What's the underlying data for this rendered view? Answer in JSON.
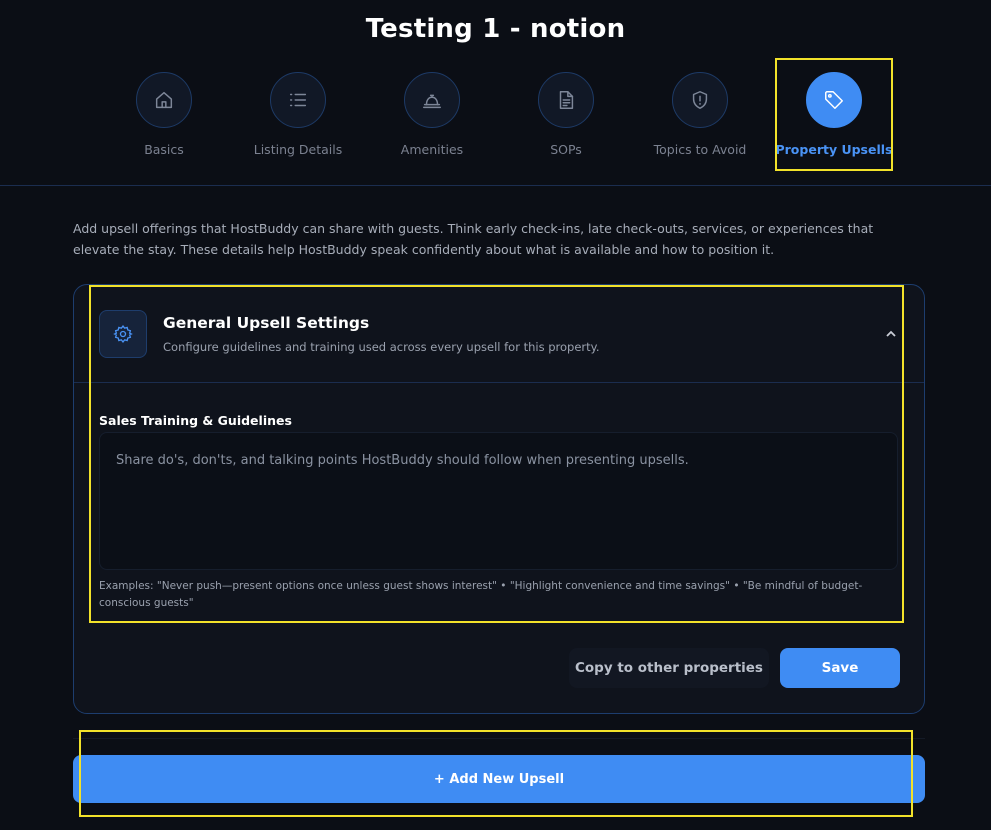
{
  "header": {
    "title": "Testing 1 - notion"
  },
  "steps": [
    {
      "label": "Basics",
      "icon": "home-icon"
    },
    {
      "label": "Listing Details",
      "icon": "list-icon"
    },
    {
      "label": "Amenities",
      "icon": "bell-icon"
    },
    {
      "label": "SOPs",
      "icon": "document-icon"
    },
    {
      "label": "Topics to Avoid",
      "icon": "shield-alert-icon"
    },
    {
      "label": "Property Upsells",
      "icon": "tag-icon",
      "active": true
    }
  ],
  "intro": "Add upsell offerings that HostBuddy can share with guests. Think early check-ins, late check-outs, services, or experiences that elevate the stay. These details help HostBuddy speak confidently about what is available and how to position it.",
  "settings_card": {
    "title": "General Upsell Settings",
    "subtitle": "Configure guidelines and training used across every upsell for this property.",
    "field_label": "Sales Training & Guidelines",
    "placeholder": "Share do's, don'ts, and talking points HostBuddy should follow when presenting upsells.",
    "examples": "Examples: \"Never push—present options once unless guest shows interest\" • \"Highlight convenience and time savings\" • \"Be mindful of budget-conscious guests\"",
    "copy_label": "Copy to other properties",
    "save_label": "Save"
  },
  "add_label": "+ Add New Upsell",
  "colors": {
    "background": "#0b0e15",
    "accent": "#3f8cf3",
    "highlight": "#f2e22a"
  }
}
